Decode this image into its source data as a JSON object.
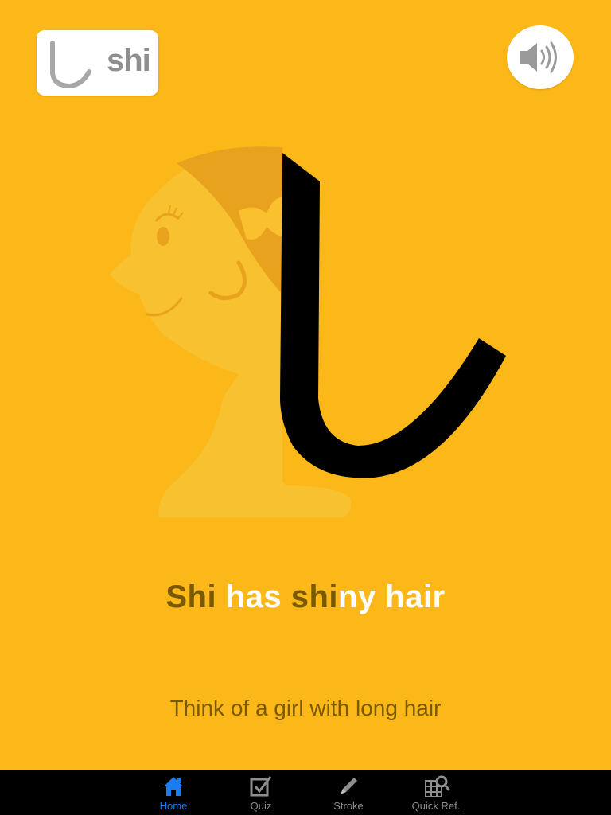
{
  "kana_card": {
    "romaji": "shi",
    "icon": "hiragana-shi-glyph"
  },
  "sound_button": {
    "icon": "speaker-icon"
  },
  "illustration": {
    "icon": "girl-with-long-hair-illustration"
  },
  "mnemonic": {
    "part1": "Shi",
    "part2": " has ",
    "part3": "shi",
    "part4": "ny hair"
  },
  "hint": "Think of a girl with long hair",
  "tabbar": {
    "tabs": [
      {
        "label": "Home",
        "icon": "home-icon",
        "active": true
      },
      {
        "label": "Quiz",
        "icon": "checkbox-icon",
        "active": false
      },
      {
        "label": "Stroke",
        "icon": "pencil-icon",
        "active": false
      },
      {
        "label": "Quick Ref.",
        "icon": "grid-search-icon",
        "active": false
      }
    ]
  },
  "colors": {
    "background": "#FCB718",
    "highlight_text": "#7a5a00",
    "tab_active": "#1a7cf0"
  }
}
